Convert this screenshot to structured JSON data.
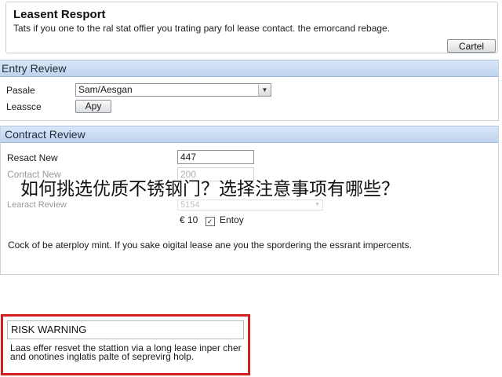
{
  "report": {
    "title": "Leasent Resport",
    "description": "Tats if you one to the ral stat offier you trating pary fol lease contact. the emorcand rebage.",
    "cancel_label": "Cartel"
  },
  "entry_review": {
    "header": "Entry Review",
    "pasale_label": "Pasale",
    "pasale_value": "Sam/Aesgan",
    "leassce_label": "Leassce",
    "apply_label": "Apy"
  },
  "contract_review": {
    "header": "Contract Review",
    "resact_label": "Resact New",
    "resact_value": "447",
    "contact_label": "Contact New",
    "contact_value": "200",
    "learact_label": "Learact Review",
    "learact_value": "5154",
    "amount_value": "€ 10",
    "entry_check_label": "Entoy",
    "notice": "Cock of be aterploy mint. If you sake oigital lease ane you the spordering the essrant impercents."
  },
  "overlay_caption": "如何挑选优质不锈钢门？选择注意事项有哪些？",
  "risk": {
    "title": "RISK WARNING",
    "text": "Laas effer resvet the stattion via a long lease inper cher and onotines inglatis palte of seprevirg holp."
  },
  "colors": {
    "panel_header": "#c9dcf2",
    "risk_border": "#d21f1f"
  }
}
